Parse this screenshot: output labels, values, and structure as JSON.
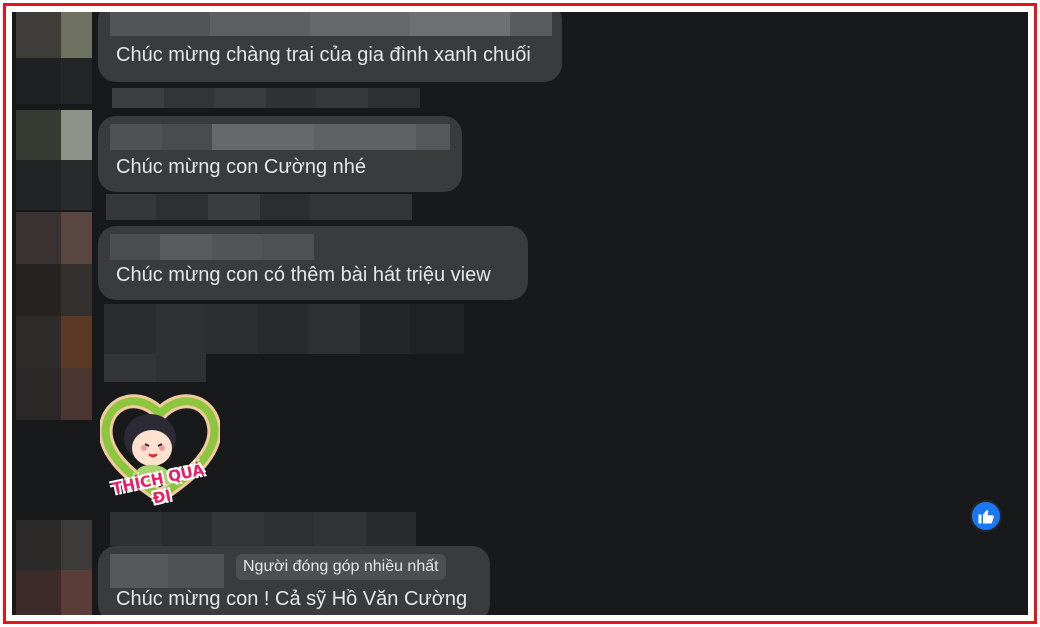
{
  "comments": [
    {
      "text": "Chúc mừng chàng trai của gia đình xanh chuối"
    },
    {
      "text": "Chúc mừng con Cường nhé"
    },
    {
      "text": "Chúc mừng con có thêm bài hát triệu view"
    },
    {
      "sticker": "thich-qua-di-heart-sticker",
      "sticker_text": "THÍCH QUÁ ĐI"
    },
    {
      "badge": "Người đóng góp nhiều nhất",
      "text": "Chúc mừng con ! Cả sỹ Hồ Văn Cường"
    }
  ],
  "reaction_icon": "like-icon",
  "colors": {
    "frame": "#e8141b",
    "background": "#18191a",
    "bubble": "#3a3b3c",
    "text": "#e4e6eb",
    "like": "#1877f2"
  }
}
